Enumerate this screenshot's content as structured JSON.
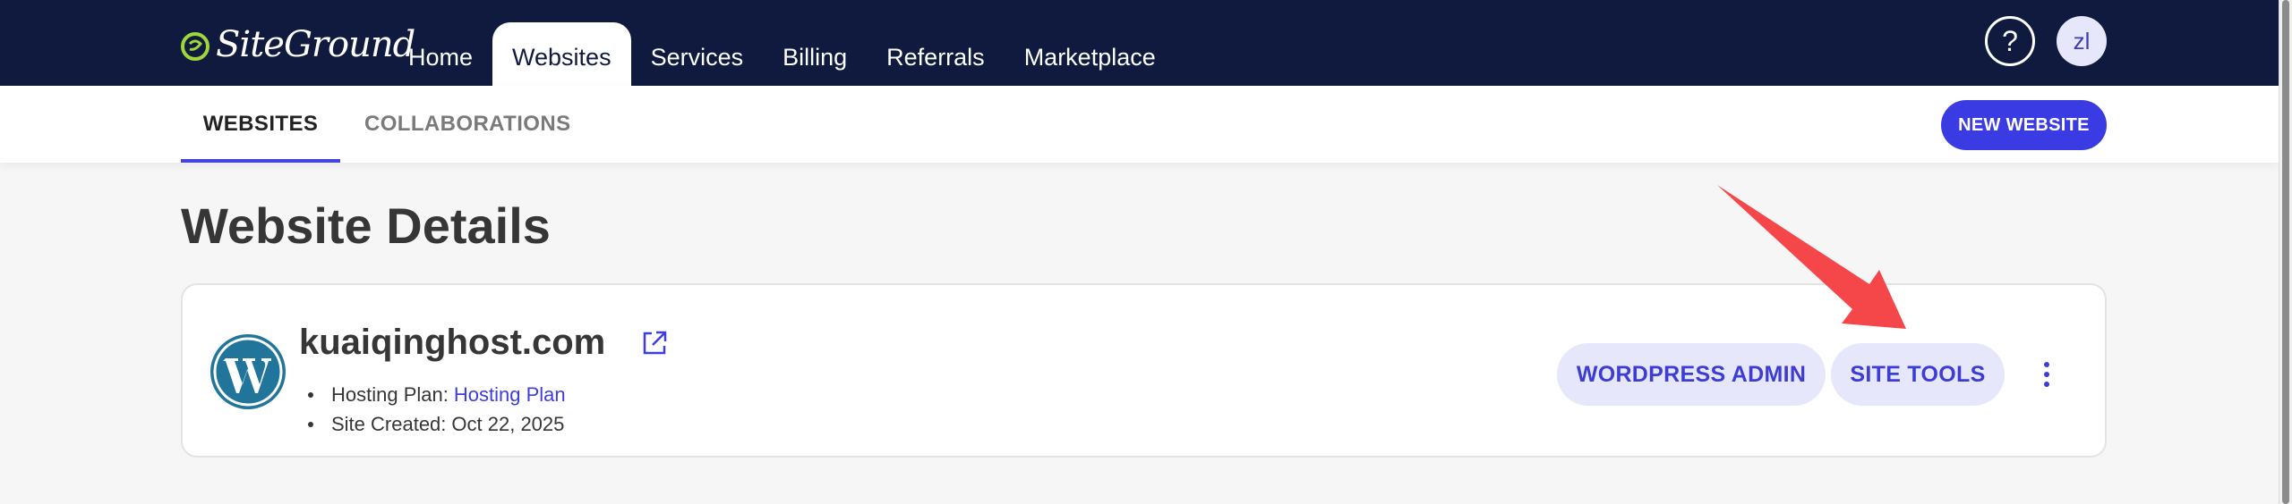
{
  "brand": {
    "name": "SiteGround",
    "logo_icon": "siteground-logo-icon",
    "accent_color": "#3b3be3",
    "nav_bg": "#0f1a3e"
  },
  "topnav": {
    "links": [
      {
        "label": "Home"
      },
      {
        "label": "Websites",
        "active": true
      },
      {
        "label": "Services"
      },
      {
        "label": "Billing"
      },
      {
        "label": "Referrals"
      },
      {
        "label": "Marketplace"
      }
    ],
    "help_label": "?",
    "avatar_initials": "zl"
  },
  "subnav": {
    "tabs": [
      {
        "label": "WEBSITES",
        "active": true
      },
      {
        "label": "COLLABORATIONS"
      }
    ],
    "new_website_label": "NEW WEBSITE"
  },
  "page": {
    "title": "Website Details"
  },
  "site": {
    "icon": "wordpress-icon",
    "domain": "kuaiqinghost.com",
    "hosting_plan_label": "Hosting Plan:",
    "hosting_plan_link": "Hosting Plan",
    "created_label": "Site Created:",
    "created_value": "Oct 22, 2025",
    "actions": {
      "wordpress_admin": "WORDPRESS ADMIN",
      "site_tools": "SITE TOOLS"
    }
  },
  "annotation": {
    "type": "arrow",
    "color": "#f5474a",
    "points_to": "SITE TOOLS"
  }
}
